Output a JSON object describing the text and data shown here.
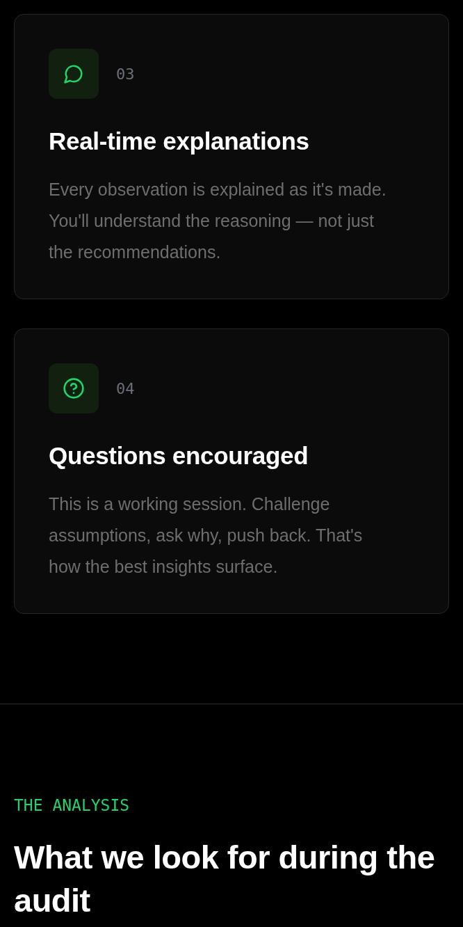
{
  "cards": [
    {
      "kind": "chat",
      "number": "03",
      "title": "Real-time explanations",
      "description": "Every observation is explained as it's made. You'll understand the reasoning — not just the recommendations."
    },
    {
      "kind": "question",
      "number": "04",
      "title": "Questions encouraged",
      "description": "This is a working session. Challenge assumptions, ask why, push back. That's how the best insights surface."
    }
  ],
  "section": {
    "eyebrow": "THE ANALYSIS",
    "heading": "What we look for during the audit"
  }
}
